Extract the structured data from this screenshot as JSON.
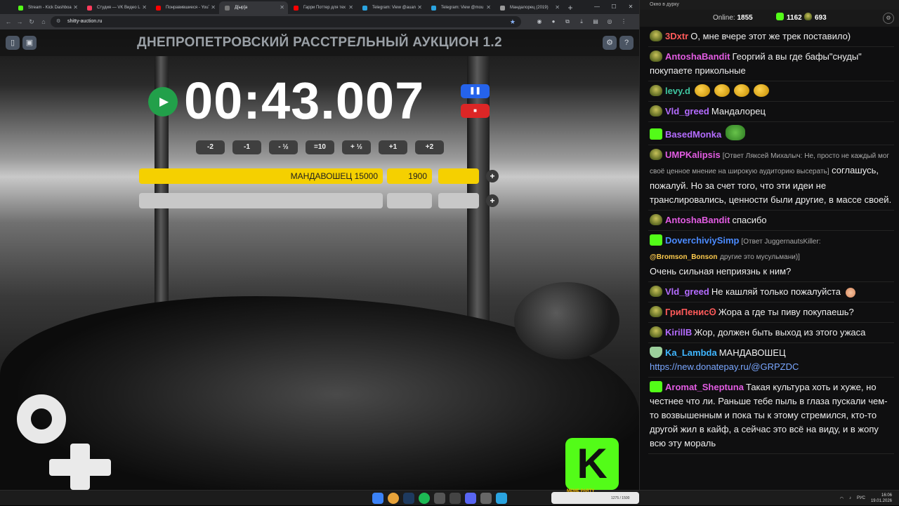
{
  "browser": {
    "tabs": [
      {
        "label": "Stream - Kick Dashboard",
        "color": "#53fc18",
        "active": false
      },
      {
        "label": "Студия — VK Видео Live",
        "color": "#ff3b5c",
        "active": false
      },
      {
        "label": "Понравившиеся - YouTube",
        "color": "#ff0000",
        "active": false
      },
      {
        "label": "Д[ыр]а",
        "color": "#777777",
        "active": true
      },
      {
        "label": "Гарри Поттер для тех",
        "color": "#ff0000",
        "active": false
      },
      {
        "label": "Telegram: View @auan",
        "color": "#2aa3df",
        "active": false
      },
      {
        "label": "Telegram: View @mou",
        "color": "#2aa3df",
        "active": false
      },
      {
        "label": "Мандалорец (2019)",
        "color": "#999999",
        "active": false
      }
    ],
    "url": "shitty-auction.ru"
  },
  "page": {
    "title": "ДНЕПРОПЕТРОВСКИЙ РАССТРЕЛЬНЫЙ АУКЦИОН 1.2",
    "timer": "00:43.007",
    "adjust_buttons": [
      "-2",
      "-1",
      "- ½",
      "=10",
      "+ ½",
      "+1",
      "+2"
    ],
    "lots": [
      {
        "name": "МАНДАВОШЕЦ 15000",
        "amount": "1900",
        "extra": "",
        "filled": true
      },
      {
        "name": "",
        "amount": "",
        "extra": "",
        "filled": false
      }
    ],
    "add_label": "+"
  },
  "chat": {
    "window_title": "Окно в дурку",
    "online_label": "Online:",
    "online_count": "1855",
    "kick_count": "1162",
    "other_count": "693",
    "messages": [
      {
        "badge": "pepe",
        "user": "3Dxtr",
        "color": "#ff5a5a",
        "text": "О, мне вчере этот же трек поставило)"
      },
      {
        "badge": "pepe",
        "user": "AntoshaBandit",
        "color": "#e25ce2",
        "text": "Георгий а вы где бафы\"снуды\" покупаете прикольные"
      },
      {
        "badge": "pepe",
        "user": "levy.d",
        "color": "#3fc6a0",
        "text": "",
        "emotes": 4
      },
      {
        "badge": "pepe",
        "user": "Vld_greed",
        "color": "#b46cff",
        "text": "Мандалорец"
      },
      {
        "badge": "kick",
        "user": "BasedMonka",
        "color": "#b46cff",
        "text": "",
        "frog": true
      },
      {
        "badge": "pepe",
        "user": "UMPKalipsis",
        "color": "#e25ce2",
        "reply": "[Ответ Ляксей Михалыч: Не, просто не каждый мог своё ценное мнение на широкую аудиторию высерать]",
        "text": "соглашусь, пожалуй. Но за счет того, что эти идеи не транслировались, ценности были другие, в массе своей."
      },
      {
        "badge": "pepe",
        "user": "AntoshaBandit",
        "color": "#e25ce2",
        "text": "спасибо"
      },
      {
        "badge": "kick",
        "user": "DoverchiviySimp",
        "color": "#4b8bff",
        "reply": "[Ответ JuggernautsKiller:",
        "mention": "@Bromson_Bonson",
        "reply_tail": "другие это мусульмани)]",
        "text": "Очень сильная неприязнь к ним?"
      },
      {
        "badge": "pepe",
        "user": "Vld_greed",
        "color": "#b46cff",
        "text": "Не кашляй только пожалуйста",
        "smile": true
      },
      {
        "badge": "pepe",
        "user": "ГриПенисꙨ",
        "color": "#ff5a5a",
        "text": "Жора а где ты пиву покупаешь?"
      },
      {
        "badge": "pepe",
        "user": "KirillB",
        "color": "#b46cff",
        "text": "Жор, должен быть выход из этого ужаса"
      },
      {
        "badge": "shield",
        "user": "Ka_Lambda",
        "color": "#3fb6ff",
        "text": "МАНДАВОШЕЦ",
        "link": "https://new.donatepay.ru/@GRPZDC"
      },
      {
        "badge": "kick",
        "user": "Aromat_Sheptuna",
        "color": "#e25ce2",
        "text": "Такая культура хоть и хуже, но честнее что ли. Раньше тебе пыль в глаза пускали чем-то возвышенным и пока ты к этому стремился, кто-то другой жил в кайф, а сейчас это всё на виду, и в жопу всю эту мораль"
      }
    ]
  },
  "taskbar": {
    "meme_party": "MEME PARTY",
    "meme_count": "1275 / 1500",
    "lang": "РУС",
    "time": "16:06",
    "date": "19.01.2026"
  }
}
